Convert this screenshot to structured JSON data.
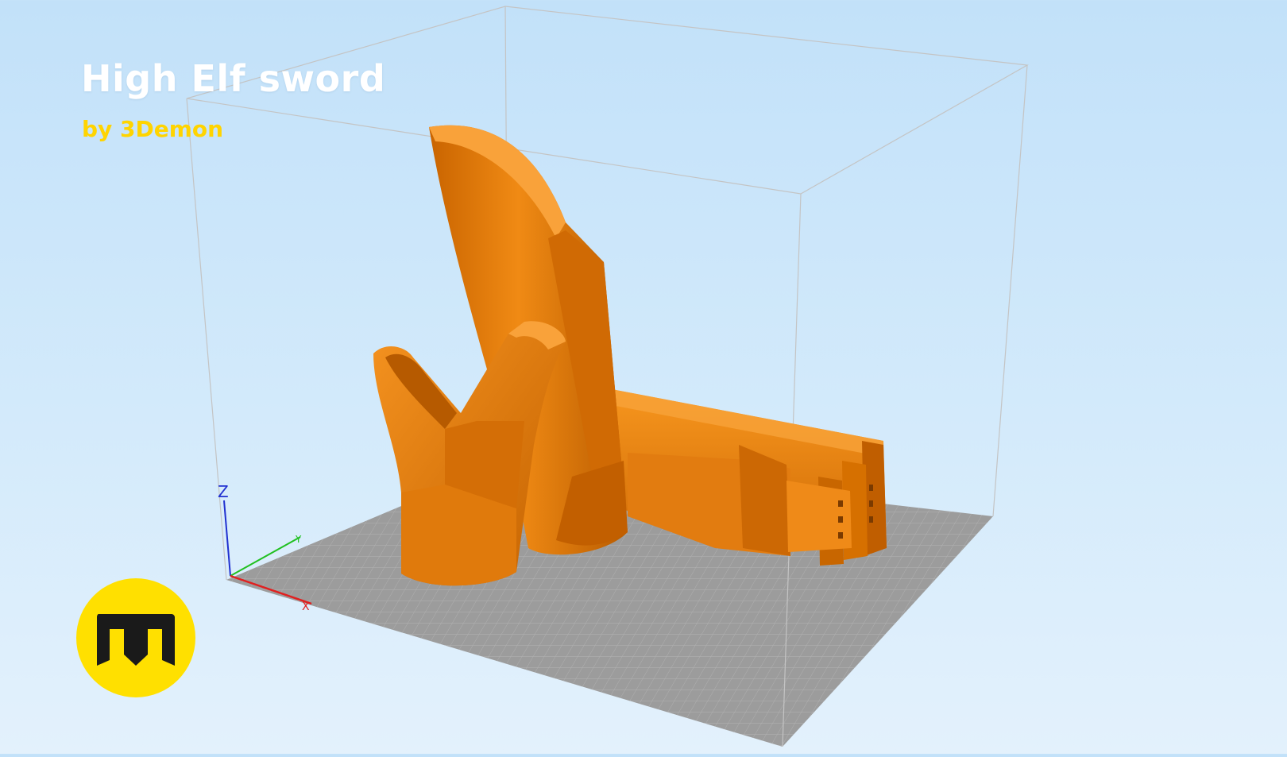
{
  "scene": {
    "title": "High Elf sword",
    "subtitle": "by 3Demon",
    "axes": {
      "z_label": "Z",
      "x_label": "X",
      "y_label": "Y"
    },
    "colors": {
      "model": "#e07a0c",
      "bed": "#9a9a9a",
      "accent_yellow": "#ffd400",
      "axis_x": "#e02020",
      "axis_y": "#20c020",
      "axis_z": "#2030d0"
    },
    "logo_icon": "3demon-logo-icon"
  }
}
